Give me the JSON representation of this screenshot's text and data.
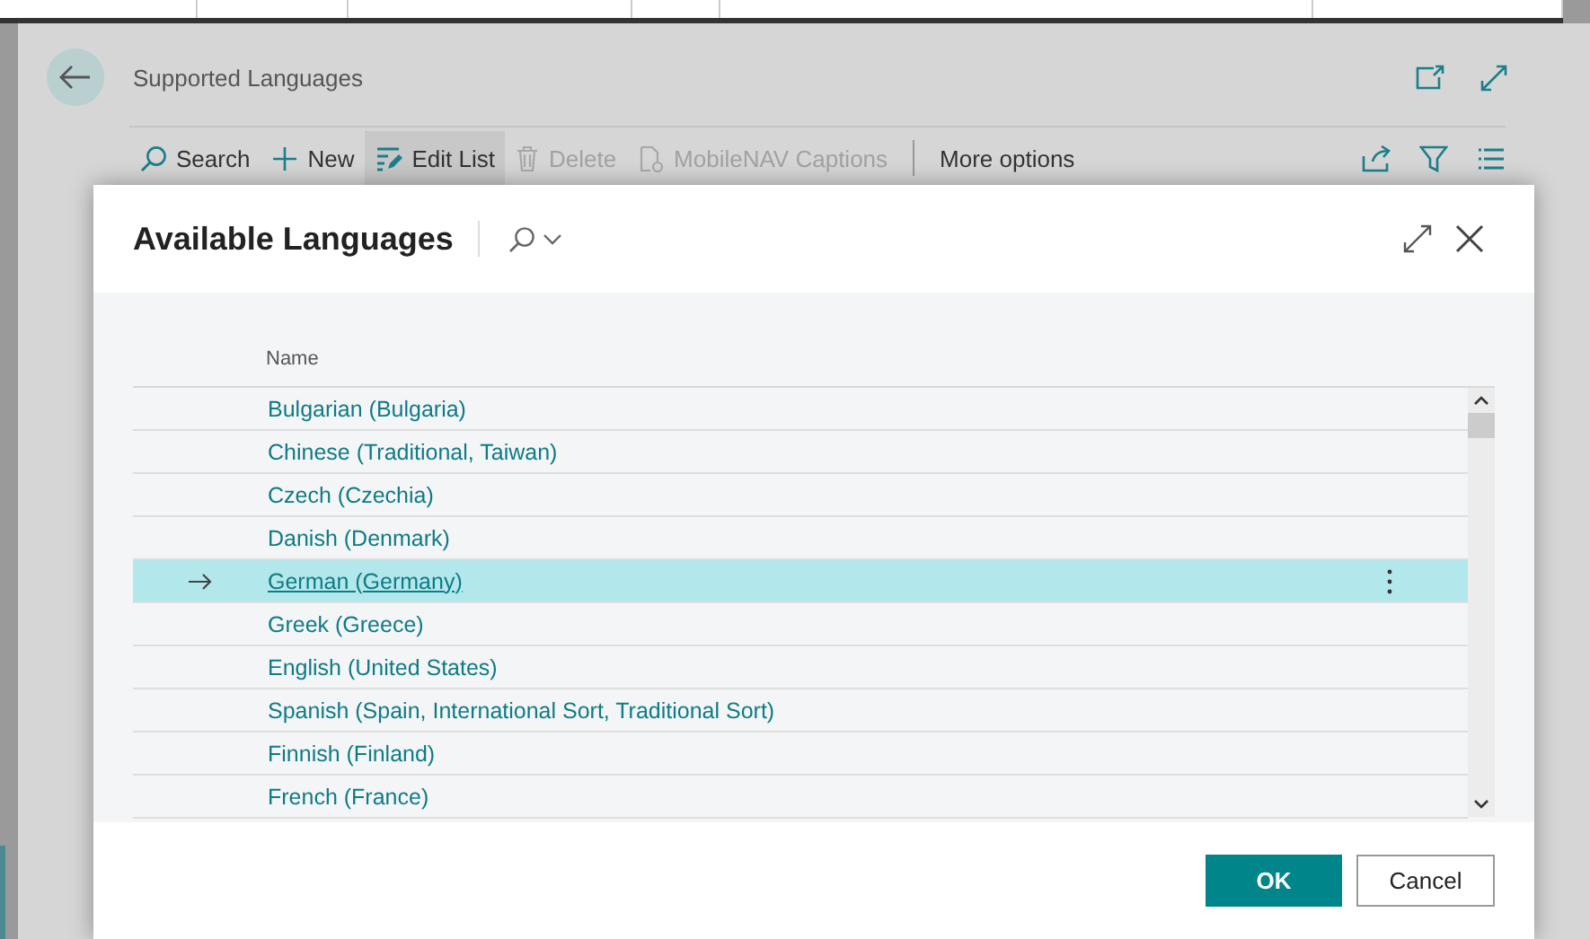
{
  "page": {
    "title": "Supported Languages",
    "actions": [
      {
        "label": "Search",
        "kind": "search",
        "disabled": false,
        "selected": false
      },
      {
        "label": "New",
        "kind": "new",
        "disabled": false,
        "selected": false
      },
      {
        "label": "Edit List",
        "kind": "edit",
        "disabled": false,
        "selected": true
      },
      {
        "label": "Delete",
        "kind": "delete",
        "disabled": true,
        "selected": false
      },
      {
        "label": "MobileNAV Captions",
        "kind": "captions",
        "disabled": true,
        "selected": false
      },
      {
        "label": "More options",
        "kind": "menu",
        "disabled": false,
        "selected": false
      }
    ]
  },
  "dialog": {
    "title": "Available Languages",
    "column": "Name",
    "rows": [
      {
        "name": "Bulgarian (Bulgaria)",
        "selected": false
      },
      {
        "name": "Chinese (Traditional, Taiwan)",
        "selected": false
      },
      {
        "name": "Czech (Czechia)",
        "selected": false
      },
      {
        "name": "Danish (Denmark)",
        "selected": false
      },
      {
        "name": "German (Germany)",
        "selected": true
      },
      {
        "name": "Greek (Greece)",
        "selected": false
      },
      {
        "name": "English (United States)",
        "selected": false
      },
      {
        "name": "Spanish (Spain, International Sort, Traditional Sort)",
        "selected": false
      },
      {
        "name": "Finnish (Finland)",
        "selected": false
      },
      {
        "name": "French (France)",
        "selected": false
      }
    ],
    "ok": "OK",
    "cancel": "Cancel"
  }
}
